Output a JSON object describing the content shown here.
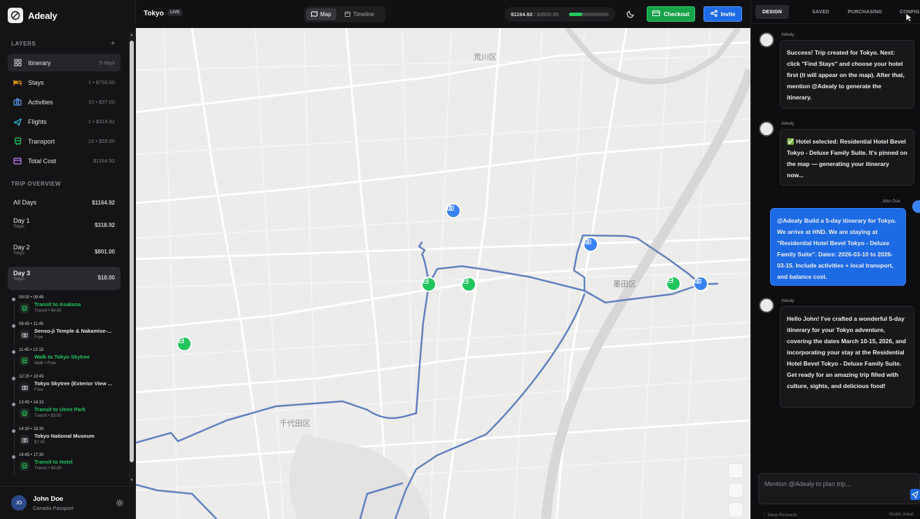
{
  "app": {
    "name": "Adealy"
  },
  "sidebar": {
    "layers_title": "LAYERS",
    "layers_add": "+",
    "layers": [
      {
        "label": "Itinerary",
        "meta": "5 days",
        "icon": "grid-icon",
        "color": "#a3a3a8"
      },
      {
        "label": "Stays",
        "meta": "1 • $750.00",
        "icon": "bed-icon",
        "color": "#f59e0b"
      },
      {
        "label": "Activities",
        "meta": "10 • $37.00",
        "icon": "camera-icon",
        "color": "#60a5fa"
      },
      {
        "label": "Flights",
        "meta": "1 • $318.92",
        "icon": "plane-icon",
        "color": "#22d3ee"
      },
      {
        "label": "Transport",
        "meta": "15 • $59.00",
        "icon": "train-icon",
        "color": "#22c55e"
      },
      {
        "label": "Total Cost",
        "meta": "$1164.92",
        "icon": "wallet-icon",
        "color": "#c084fc"
      }
    ],
    "overview_title": "TRIP OVERVIEW",
    "days": [
      {
        "title": "All Days",
        "sub": "",
        "cost": "$1164.92"
      },
      {
        "title": "Day 1",
        "sub": "Tokyo",
        "cost": "$318.92"
      },
      {
        "title": "Day 2",
        "sub": "Tokyo",
        "cost": "$801.00"
      },
      {
        "title": "Day 3",
        "sub": "Tokyo",
        "cost": "$18.00"
      }
    ],
    "timeline": [
      {
        "time": "09:00  •  09:45",
        "name": "Transit to Asakusa",
        "sub": "Transit • $4.00",
        "type": "transit"
      },
      {
        "time": "09:45  •  11:45",
        "name": "Senso-ji Temple & Nakamise-...",
        "sub": "Free",
        "type": "activity"
      },
      {
        "time": "11:45  •  12:15",
        "name": "Walk to Tokyo Skytree",
        "sub": "Walk • Free",
        "type": "transit"
      },
      {
        "time": "12:15  •  13:45",
        "name": "Tokyo Skytree (Exterior View ...",
        "sub": "Free",
        "type": "activity"
      },
      {
        "time": "13:45  •  14:15",
        "name": "Transit to Ueno Park",
        "sub": "Transit • $3.00",
        "type": "transit"
      },
      {
        "time": "14:30  •  16:30",
        "name": "Tokyo National Museum",
        "sub": "$7.00",
        "type": "activity"
      },
      {
        "time": "16:45  •  17:30",
        "name": "Transit to Hotel",
        "sub": "Transit • $4.00",
        "type": "transit"
      }
    ],
    "user": {
      "initials": "JO",
      "name": "John Doe",
      "passport": "Canada Passport"
    }
  },
  "topbar": {
    "city": "Tokyo",
    "live": "LIVE",
    "view_map": "Map",
    "view_timeline": "Timeline",
    "budget_spent": "$1164.92",
    "budget_total": "/ $3500.00",
    "budget_fraction": 0.333,
    "checkout": "Checkout",
    "invite": "Invite"
  },
  "map": {
    "labels": [
      "荒川区",
      "墨田区",
      "千代田区"
    ]
  },
  "panel": {
    "tabs": [
      "DESIGN",
      "SAVED",
      "PURCHASING",
      "CONFIG"
    ],
    "messages": [
      {
        "sender": "Adealy",
        "text": "Success! Trip created for Tokyo. Next: click \"Find Stays\" and choose your hotel first (it will appear on the map). After that, mention @Adealy to generate the itinerary."
      },
      {
        "sender": "Adealy",
        "text": "✅ Hotel selected: Residential Hotel Bevel Tokyo - Deluxe Family Suite. It's pinned on the map — generating your itinerary now..."
      },
      {
        "sender": "John Doe",
        "text": "@Adealy Build a 5-day itinerary for Tokyo. We arrive at HND. We are staying at \"Residential Hotel Bevel Tokyo - Deluxe Family Suite\". Dates: 2026-03-10 to 2026-03-15. Include activities + local transport, and balance cost."
      },
      {
        "sender": "Adealy",
        "text": "Hello John! I've crafted a wonderful 5-day itinerary for your Tokyo adventure, covering the dates March 10-15, 2026, and incorporating your stay at the Residential Hotel Bevel Tokyo - Deluxe Family Suite. Get ready for an amazing trip filled with culture, sights, and delicious food!"
      }
    ],
    "composer_placeholder": "Mention @Adealy to plan trip...",
    "footer_left": "Deep Research",
    "footer_right": "Model: Adeal"
  }
}
